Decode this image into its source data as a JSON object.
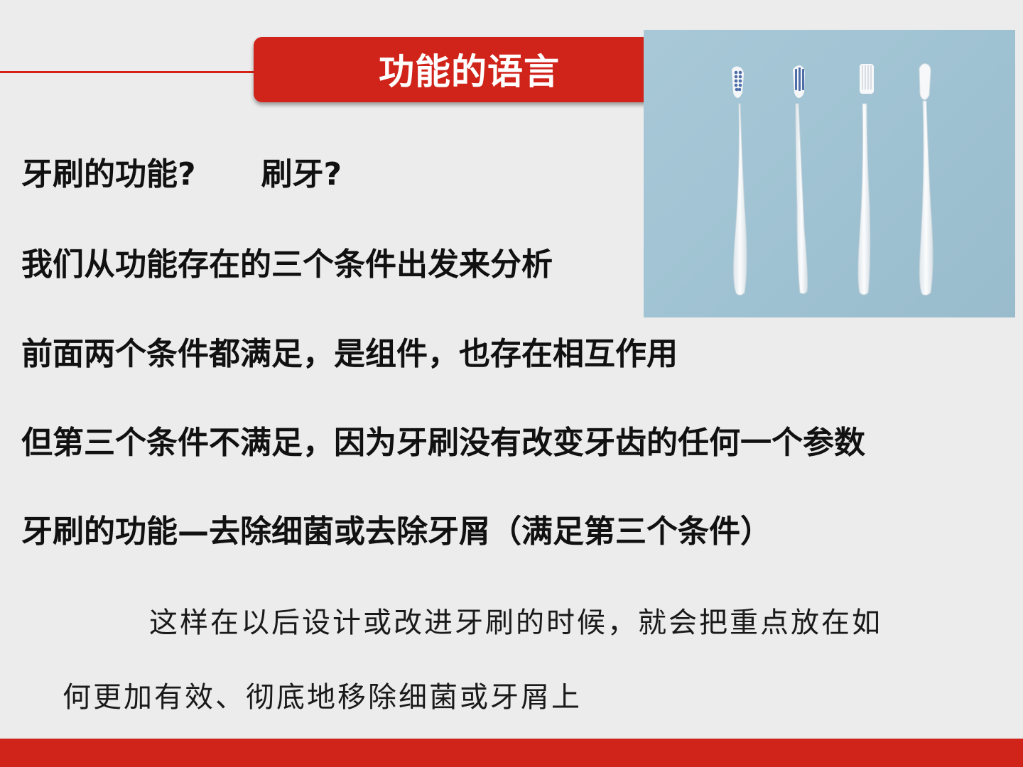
{
  "title": "功能的语言",
  "photo": {
    "icon": "toothbrush-icon",
    "count": 4,
    "background_color": "#a2c4d4"
  },
  "lines": [
    {
      "question": "牙刷的功能?",
      "answer": "刷牙?"
    },
    {
      "text": "我们从功能存在的三个条件出发来分析"
    },
    {
      "text": "前面两个条件都满足，是组件，也存在相互作用"
    },
    {
      "text": "但第三个条件不满足，因为牙刷没有改变牙齿的任何一个参数"
    },
    {
      "text": "牙刷的功能—去除细菌或去除牙屑（满足第三个条件）"
    }
  ],
  "paragraph": {
    "line1": "这样在以后设计或改进牙刷的时候，就会把重点放在如",
    "line2": "何更加有效、彻底地移除细菌或牙屑上"
  },
  "colors": {
    "accent": "#d0241a",
    "background": "#ececec",
    "text": "#111111"
  }
}
